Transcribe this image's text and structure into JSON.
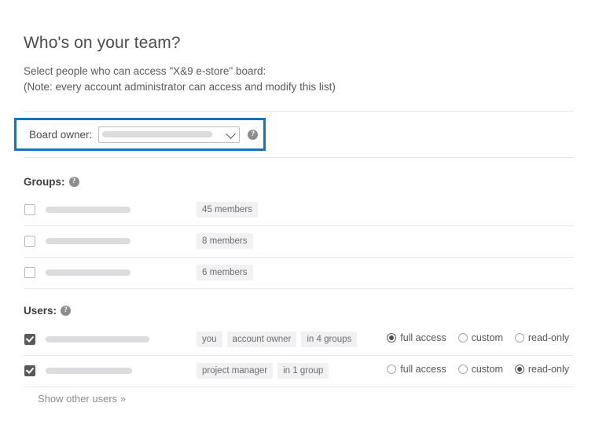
{
  "page": {
    "title": "Who's on your team?",
    "intro_line1": "Select people who can access \"X&9 e-store\" board:",
    "intro_line2": "(Note: every account administrator can access and modify this list)"
  },
  "board_owner": {
    "label": "Board owner:",
    "selected_value": "",
    "help_glyph": "?",
    "highlight_color": "#1b72b8"
  },
  "groups_section": {
    "heading": "Groups:",
    "help_glyph": "?",
    "rows": [
      {
        "checked": false,
        "name_width": 108,
        "members": "45 members"
      },
      {
        "checked": false,
        "name_width": 108,
        "members": "8 members"
      },
      {
        "checked": false,
        "name_width": 108,
        "members": "6 members"
      }
    ]
  },
  "users_section": {
    "heading": "Users:",
    "help_glyph": "?",
    "permission_options": [
      "full access",
      "custom",
      "read-only"
    ],
    "rows": [
      {
        "checked": true,
        "name_width": 132,
        "tags": [
          "you",
          "account owner",
          "in 4 groups"
        ],
        "permission": "full access"
      },
      {
        "checked": true,
        "name_width": 110,
        "tags": [
          "project manager",
          "in 1 group"
        ],
        "permission": "read-only"
      }
    ]
  },
  "footer": {
    "show_more_label": "Show other users »"
  }
}
